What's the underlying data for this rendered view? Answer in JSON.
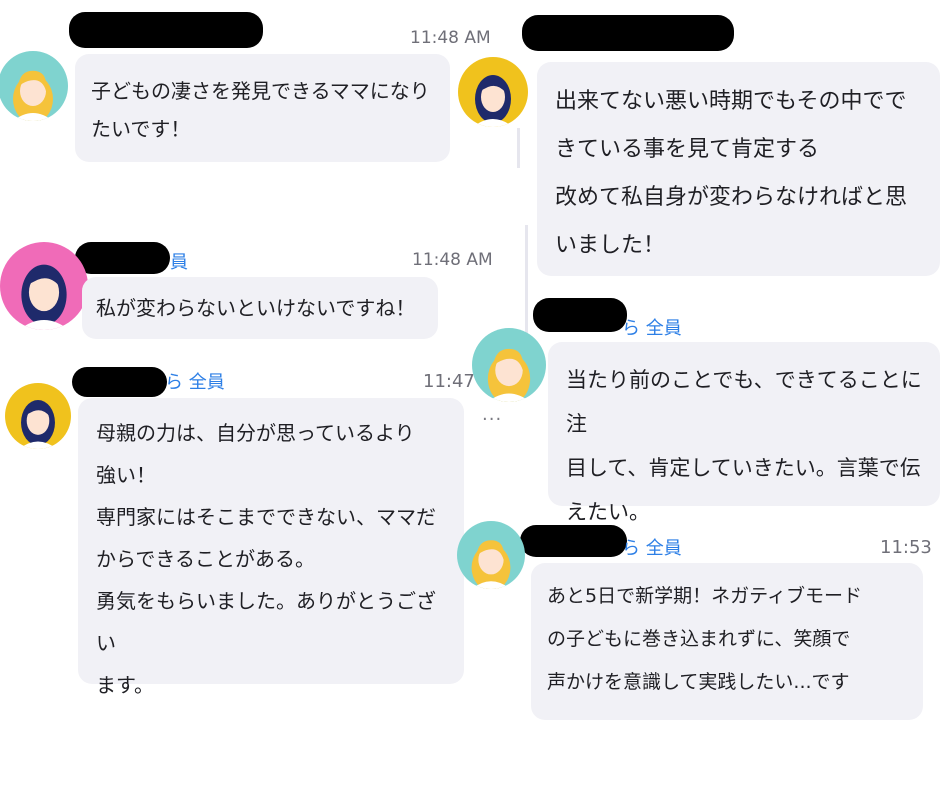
{
  "messages": [
    {
      "id": "m1",
      "time": "11:48 AM",
      "to_label": "",
      "text": "子どもの凄さを発見できるママになり\nたいです！"
    },
    {
      "id": "m2",
      "time": "11:48 AM",
      "to_label": "員",
      "text": "私が変わらないといけないですね！"
    },
    {
      "id": "m3",
      "time": "11:47",
      "to_label": "ら 全員",
      "text": "母親の力は、自分が思っているより\n強い！\n専門家にはそこまでできない、ママだ\nからできることがある。\n勇気をもらいました。ありがとうござい\nます。"
    },
    {
      "id": "m4",
      "time": "",
      "to_label": "",
      "text": "出来てない悪い時期でもその中でで\nきている事を見て肯定する\n改めて私自身が変わらなければと思\nいました！"
    },
    {
      "id": "m5",
      "time": "",
      "to_label": "ら 全員",
      "text": "当たり前のことでも、できてることに注\n目して、肯定していきたい。言葉で伝\nえたい。"
    },
    {
      "id": "m6",
      "time": "11:53 ",
      "to_label": "ら 全員",
      "text": "あと5日で新学期！ネガティブモード\nの子どもに巻き込まれずに、笑顔で\n声かけを意識して実践したい...です"
    }
  ],
  "misc": {
    "ellipsis": "..."
  },
  "colors": {
    "bubble": "#f1f1f6",
    "link": "#2d7fe6",
    "avatar_teal": "#7fd3cf",
    "avatar_yellow": "#f0c21d",
    "avatar_pink": "#f06bb8",
    "redaction": "#000000"
  },
  "icons": [
    "avatar-blonde-woman-icon",
    "avatar-dark-hair-woman-icon"
  ]
}
